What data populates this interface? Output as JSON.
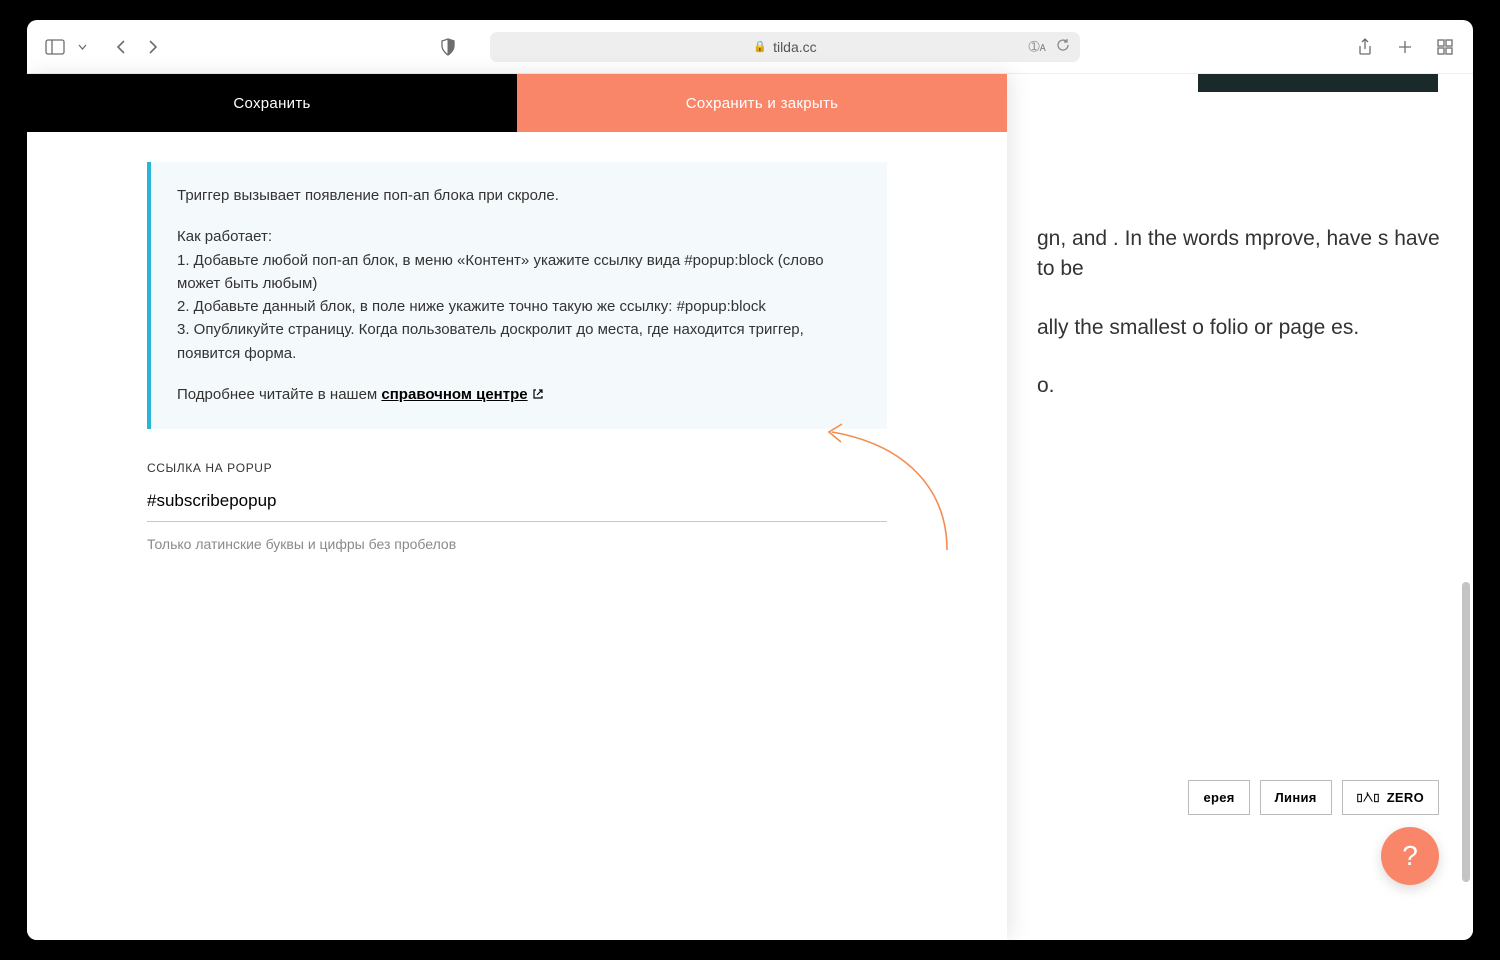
{
  "browser": {
    "url": "tilda.cc"
  },
  "panel": {
    "save": "Сохранить",
    "save_close": "Сохранить и закрыть"
  },
  "info": {
    "p1": "Триггер вызывает появление поп-ап блока при скроле.",
    "how_title": "Как работает:",
    "l1": "1. Добавьте любой поп-ап блок, в меню «Контент» укажите ссылку вида #popup:block (слово может быть любым)",
    "l2": "2. Добавьте данный блок, в поле ниже укажите точно такую же ссылку: #popup:block",
    "l3": "3. Опубликуйте страницу. Когда пользователь доскролит до места, где находится триггер, появится форма.",
    "more_prefix": "Подробнее читайте в нашем ",
    "more_link": "справочном центре"
  },
  "field": {
    "label": "ССЫЛКА НА POPUP",
    "value": "#subscribepopup",
    "hint": "Только латинские буквы и цифры без пробелов"
  },
  "bg": {
    "p1": "gn, and . In the words mprove, have s have to be",
    "p2": "ally the smallest o folio or page es.",
    "p3": "о."
  },
  "buttons": {
    "gallery": "ерея",
    "line": "Линия",
    "zero": "ZERO"
  },
  "help": "?"
}
